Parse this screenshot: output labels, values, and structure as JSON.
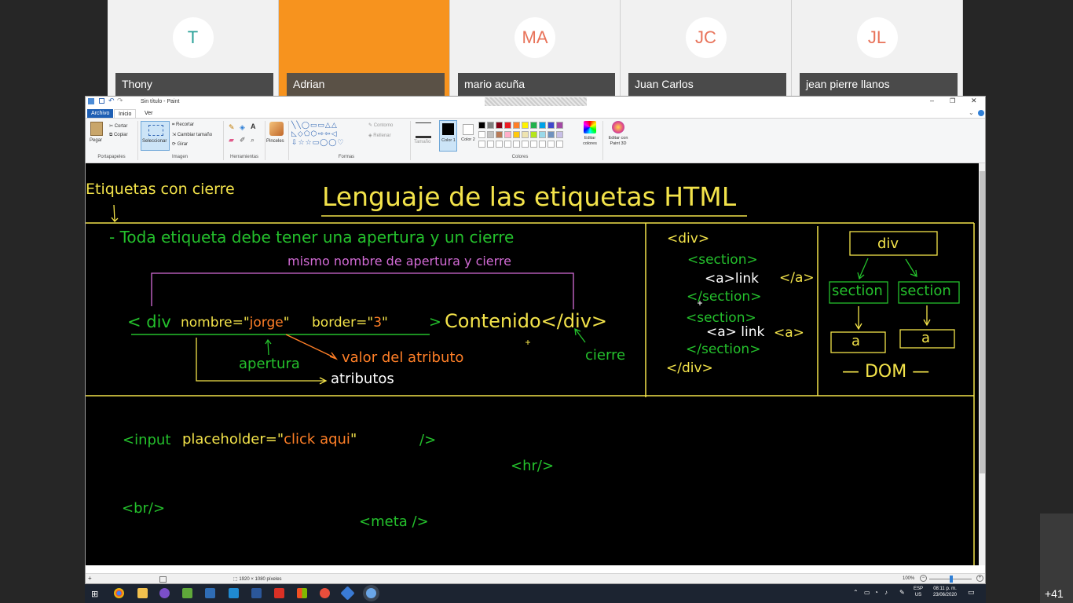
{
  "participants": [
    {
      "initials": "T",
      "name": "Thony",
      "color": "#2aa198"
    },
    {
      "initials": "",
      "name": "Adrian",
      "color": "#f7931e"
    },
    {
      "initials": "MA",
      "name": "mario acuña",
      "color": "#e8735a"
    },
    {
      "initials": "JC",
      "name": "Juan Carlos",
      "color": "#e8735a"
    },
    {
      "initials": "JL",
      "name": "jean pierre llanos",
      "color": "#e8735a"
    }
  ],
  "more_participants": "+41",
  "paint": {
    "title": "Sin título - Paint",
    "tabs": [
      "Archivo",
      "Inicio",
      "Ver"
    ],
    "ribbon": {
      "clipboard": {
        "paste": "Pegar",
        "cut": "Cortar",
        "copy": "Copiar",
        "group": "Portapapeles"
      },
      "image": {
        "select": "Seleccionar",
        "crop": "Recortar",
        "resize": "Cambiar tamaño",
        "rotate": "Girar",
        "group": "Imagen"
      },
      "tools": {
        "group": "Herramientas"
      },
      "brushes": "Pinceles",
      "shapes": {
        "outline": "Contorno",
        "fill": "Rellenar",
        "group": "Formas"
      },
      "size": "Tamaño",
      "color1": "Color 1",
      "color2": "Color 2",
      "edit_colors": "Editar colores",
      "paint3d": "Editar con Paint 3D",
      "colors_group": "Colores"
    },
    "palette": [
      "#000000",
      "#7f7f7f",
      "#880015",
      "#ed1c24",
      "#ff7f27",
      "#fff200",
      "#22b14c",
      "#00a2e8",
      "#3f48cc",
      "#a349a4",
      "#ffffff",
      "#c3c3c3",
      "#b97a57",
      "#ffaec9",
      "#ffc90e",
      "#efe4b0",
      "#b5e61d",
      "#99d9ea",
      "#7092be",
      "#c8bfe7"
    ],
    "status": {
      "dimensions": "1920 × 1080 píxeles",
      "zoom": "100%"
    }
  },
  "whiteboard": {
    "label_closing_tags": "Etiquetas con cierre",
    "title": "Lenguaje de las etiquetas HTML",
    "rule": "- Toda etiqueta debe tener una apertura y un cierre",
    "same_name": "mismo nombre de apertura y cierre",
    "open_lt": "< div",
    "attr1_name": "nombre=\"",
    "attr1_value": "jorge",
    "attr1_end": "\"",
    "attr2_name": "border=\"",
    "attr2_value": "3",
    "attr2_end": "\"",
    "close_gt": ">",
    "content": "Contenido</div>",
    "label_value": "valor del atributo",
    "label_open": "apertura",
    "label_attrs": "atributos",
    "label_close": "cierre",
    "code": [
      "<div>",
      "<section>",
      "<a>link",
      "</a>",
      "</section>",
      "<section>",
      "<a> link",
      "<a>",
      "</section>",
      "</div>"
    ],
    "dom": {
      "root": "div",
      "child1": "section",
      "child2": "section",
      "leaf1": "a",
      "leaf2": "a",
      "label": "— DOM —"
    },
    "input_open": "<input",
    "input_attr": "placeholder=\"",
    "input_value": "click aqui",
    "input_attr_end": "\"",
    "input_close": "/>",
    "hr": "<hr/>",
    "br": "<br/>",
    "meta": "<meta />"
  },
  "tray": {
    "lang": "ESP",
    "layout": "US",
    "time": "08:11 p. m.",
    "date": "23/06/2020"
  }
}
